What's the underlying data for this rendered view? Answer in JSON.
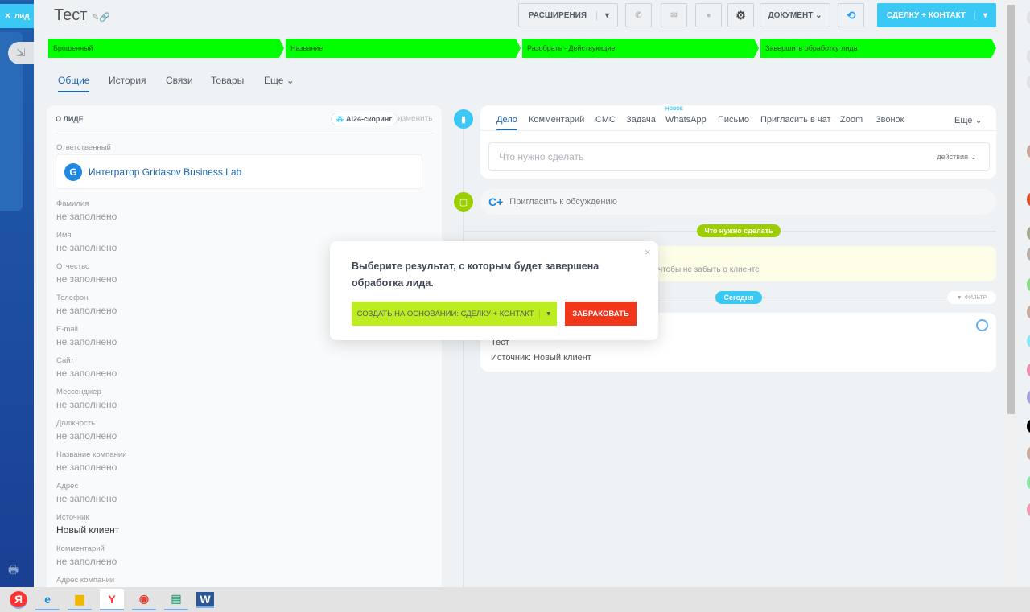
{
  "sidebar": {
    "tab_label": "лид"
  },
  "header": {
    "title": "Тест",
    "buttons": {
      "extensions": "РАСШИРЕНИЯ",
      "document": "ДОКУМЕНТ",
      "convert": "СДЕЛКУ + КОНТАКТ"
    }
  },
  "stages": [
    "Брошенный",
    "Название",
    "Разобрать - Действующие",
    "Завершить обработку лида"
  ],
  "stage_color": "#00ff00",
  "tabs": [
    "Общие",
    "История",
    "Связи",
    "Товары",
    "Еще"
  ],
  "lead": {
    "heading": "О ЛИДЕ",
    "scoring": "AI24-скоринг",
    "edit": "изменить",
    "responsible_label": "Ответственный",
    "responsible": "Интегратор Gridasov Business Lab",
    "fields": [
      {
        "label": "Фамилия",
        "value": "не заполнено"
      },
      {
        "label": "Имя",
        "value": "не заполнено"
      },
      {
        "label": "Отчество",
        "value": "не заполнено"
      },
      {
        "label": "Телефон",
        "value": "не заполнено"
      },
      {
        "label": "E-mail",
        "value": "не заполнено"
      },
      {
        "label": "Сайт",
        "value": "не заполнено"
      },
      {
        "label": "Мессенджер",
        "value": "не заполнено"
      },
      {
        "label": "Должность",
        "value": "не заполнено"
      },
      {
        "label": "Название компании",
        "value": "не заполнено"
      },
      {
        "label": "Адрес",
        "value": "не заполнено"
      },
      {
        "label": "Источник",
        "value": "Новый клиент"
      },
      {
        "label": "Комментарий",
        "value": "не заполнено"
      },
      {
        "label": "Адрес компании",
        "value": ""
      }
    ]
  },
  "timeline": {
    "tabs": [
      "Дело",
      "Комментарий",
      "СМС",
      "Задача",
      "WhatsApp",
      "Письмо",
      "Пригласить в чат",
      "Zoom",
      "Звонок"
    ],
    "new_badge": "НОВОЕ",
    "more": "Еще",
    "placeholder": "Что нужно сделать",
    "actions": "действия",
    "invite": "Пригласить к обсуждению",
    "todo_pill": "Что нужно сделать",
    "hint": "чтобы не забыть о клиенте",
    "today": "Сегодня",
    "filter": "ФИЛЬТР",
    "entry_title": "Тест",
    "entry_source": "Источник: Новый клиент"
  },
  "modal": {
    "text": "Выберите результат, с которым будет завершена обработка лида.",
    "create": "СОЗДАТЬ НА ОСНОВАНИИ: СДЕЛКУ + КОНТАКТ",
    "reject": "ЗАБРАКОВАТЬ",
    "close": "×"
  },
  "colors": {
    "accent": "#3bc8f5",
    "primary_green": "#bbed21",
    "danger": "#f1361a",
    "todo": "#9dcf00"
  }
}
